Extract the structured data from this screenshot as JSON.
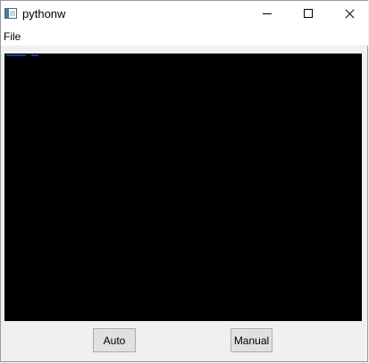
{
  "window": {
    "title": "pythonw"
  },
  "menubar": {
    "items": [
      {
        "label": "File"
      }
    ]
  },
  "buttons": {
    "auto_label": "Auto",
    "manual_label": "Manual"
  },
  "colors": {
    "canvas_background": "#000000",
    "window_background": "#f0f0f0"
  }
}
